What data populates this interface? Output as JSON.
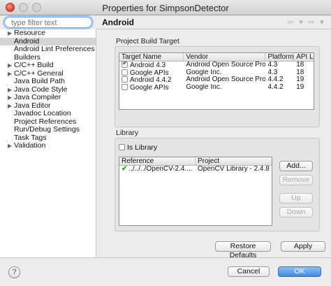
{
  "window": {
    "title": "Properties for SimpsonDetector"
  },
  "filter": {
    "placeholder": "type filter text"
  },
  "tree": {
    "items": [
      {
        "label": "Resource",
        "expandable": true,
        "selected": false
      },
      {
        "label": "Android",
        "expandable": false,
        "selected": true
      },
      {
        "label": "Android Lint Preferences",
        "expandable": false,
        "selected": false
      },
      {
        "label": "Builders",
        "expandable": false,
        "selected": false
      },
      {
        "label": "C/C++ Build",
        "expandable": true,
        "selected": false
      },
      {
        "label": "C/C++ General",
        "expandable": true,
        "selected": false
      },
      {
        "label": "Java Build Path",
        "expandable": false,
        "selected": false
      },
      {
        "label": "Java Code Style",
        "expandable": true,
        "selected": false
      },
      {
        "label": "Java Compiler",
        "expandable": true,
        "selected": false
      },
      {
        "label": "Java Editor",
        "expandable": true,
        "selected": false
      },
      {
        "label": "Javadoc Location",
        "expandable": false,
        "selected": false
      },
      {
        "label": "Project References",
        "expandable": false,
        "selected": false
      },
      {
        "label": "Run/Debug Settings",
        "expandable": false,
        "selected": false
      },
      {
        "label": "Task Tags",
        "expandable": false,
        "selected": false
      },
      {
        "label": "Validation",
        "expandable": true,
        "selected": false
      }
    ]
  },
  "header": {
    "title": "Android",
    "icons": [
      "back-arrow-icon",
      "dropdown-icon",
      "forward-arrow-icon",
      "dropdown-icon"
    ]
  },
  "build_target": {
    "group_label": "Project Build Target",
    "columns": [
      "Target Name",
      "Vendor",
      "Platform",
      "API Le"
    ],
    "rows": [
      {
        "checked": true,
        "name": "Android 4.3",
        "vendor": "Android Open Source Project",
        "platform": "4.3",
        "api": "18"
      },
      {
        "checked": false,
        "name": "Google APIs",
        "vendor": "Google Inc.",
        "platform": "4.3",
        "api": "18"
      },
      {
        "checked": false,
        "name": "Android 4.4.2",
        "vendor": "Android Open Source Project",
        "platform": "4.4.2",
        "api": "19"
      },
      {
        "checked": false,
        "name": "Google APIs",
        "vendor": "Google Inc.",
        "platform": "4.4.2",
        "api": "19"
      }
    ]
  },
  "library": {
    "group_label": "Library",
    "is_library_label": "Is Library",
    "is_library_checked": false,
    "columns": [
      "Reference",
      "Project"
    ],
    "rows": [
      {
        "reference": "../../../OpenCV-2.4....",
        "project": "OpenCV Library - 2.4.8"
      }
    ],
    "buttons": {
      "add": "Add...",
      "remove": "Remove",
      "up": "Up",
      "down": "Down"
    }
  },
  "actions": {
    "restore_defaults": "Restore Defaults",
    "apply": "Apply"
  },
  "footer": {
    "help": "?",
    "cancel": "Cancel",
    "ok": "OK"
  },
  "colors": {
    "accent": "#3f8ae4",
    "selection": "#d4d4d4",
    "check_green": "#2aa32a"
  }
}
